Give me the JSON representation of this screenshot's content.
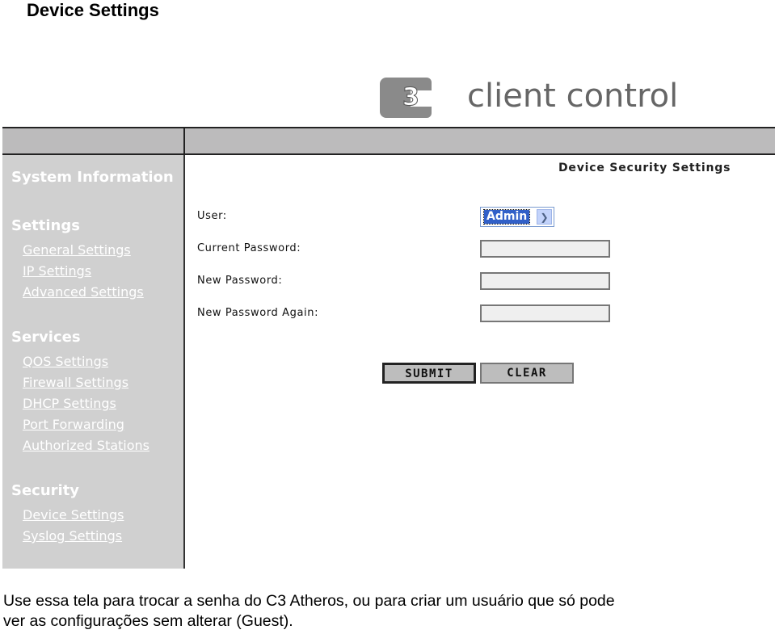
{
  "document": {
    "title": "Device Settings",
    "caption_lines": [
      "Use essa tela para trocar a senha do C3 Atheros, ou para criar um usuário que só pode",
      "ver as configurações sem alterar (Guest)."
    ]
  },
  "app": {
    "logo_text": "client control",
    "logo_mark": "C3",
    "sidebar": {
      "sections": [
        {
          "label": "System Information",
          "items": []
        },
        {
          "label": "Settings",
          "items": [
            "General Settings",
            "IP Settings",
            "Advanced Settings"
          ]
        },
        {
          "label": "Services",
          "items": [
            "QOS Settings",
            "Firewall Settings",
            "DHCP Settings",
            "Port Forwarding",
            "Authorized Stations"
          ]
        },
        {
          "label": "Security",
          "items": [
            "Device Settings",
            "Syslog Settings"
          ]
        }
      ]
    },
    "panel": {
      "title": "Device Security Settings",
      "user_label": "User:",
      "user_value": "Admin",
      "current_password_label": "Current Password:",
      "current_password_value": "",
      "new_password_label": "New Password:",
      "new_password_value": "",
      "new_password_again_label": "New Password Again:",
      "new_password_again_value": "",
      "submit_label": "SUBMIT",
      "clear_label": "CLEAR"
    }
  },
  "colors": {
    "sidebar": "#d0d0d0",
    "header_bar": "#bcbbbc",
    "select_highlight": "#3160c8"
  }
}
